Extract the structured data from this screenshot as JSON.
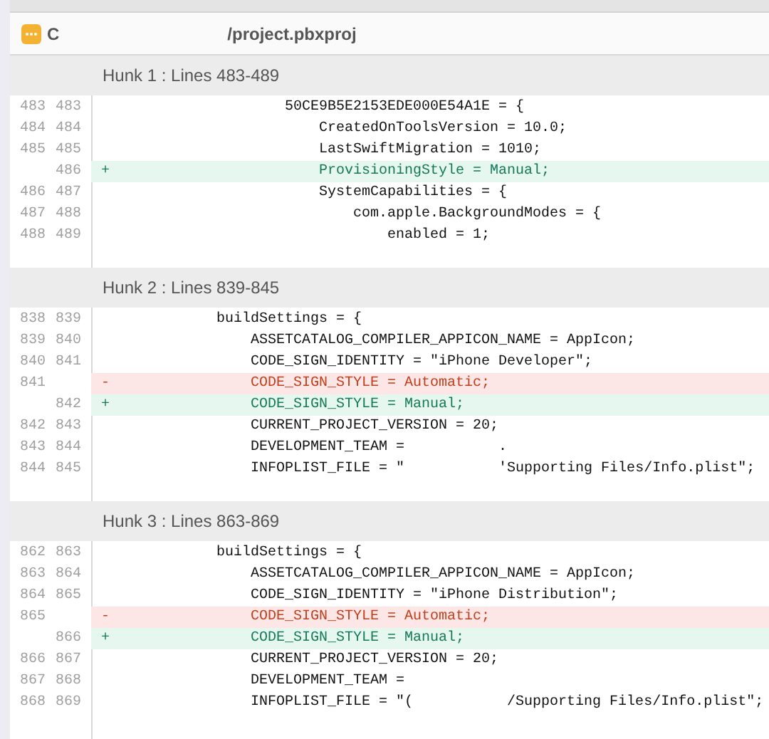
{
  "file": {
    "path": [
      "C",
      "/project.pbxproj"
    ]
  },
  "hunks": [
    {
      "title": "Hunk 1 : Lines 483-489",
      "lines": [
        {
          "kind": "context",
          "old": "483",
          "new": "483",
          "segments": [
            "                    50CE9B5E2153EDE000E54A1E = {"
          ]
        },
        {
          "kind": "context",
          "old": "484",
          "new": "484",
          "segments": [
            "                        CreatedOnToolsVersion = 10.0;"
          ]
        },
        {
          "kind": "context",
          "old": "485",
          "new": "485",
          "segments": [
            "                        LastSwiftMigration = 1010;"
          ]
        },
        {
          "kind": "added",
          "new": "486",
          "marker": "+",
          "segments": [
            "                        ProvisioningStyle = Manual;"
          ]
        },
        {
          "kind": "context",
          "old": "486",
          "new": "487",
          "segments": [
            "                        SystemCapabilities = {"
          ]
        },
        {
          "kind": "context",
          "old": "487",
          "new": "488",
          "segments": [
            "                            com.apple.BackgroundModes = {"
          ]
        },
        {
          "kind": "context",
          "old": "488",
          "new": "489",
          "segments": [
            "                                enabled = 1;"
          ]
        }
      ]
    },
    {
      "title": "Hunk 2 : Lines 839-845",
      "lines": [
        {
          "kind": "context",
          "old": "838",
          "new": "839",
          "segments": [
            "            buildSettings = {"
          ]
        },
        {
          "kind": "context",
          "old": "839",
          "new": "840",
          "segments": [
            "                ASSETCATALOG_COMPILER_APPICON_NAME = AppIcon;"
          ]
        },
        {
          "kind": "context",
          "old": "840",
          "new": "841",
          "segments": [
            "                CODE_SIGN_IDENTITY = \"iPhone Developer\";"
          ]
        },
        {
          "kind": "removed",
          "old": "841",
          "marker": "-",
          "segments": [
            "                CODE_SIGN_STYLE = Automatic;"
          ]
        },
        {
          "kind": "added",
          "new": "842",
          "marker": "+",
          "segments": [
            "                CODE_SIGN_STYLE = Manual;"
          ]
        },
        {
          "kind": "context",
          "old": "842",
          "new": "843",
          "segments": [
            "                CURRENT_PROJECT_VERSION = 20;"
          ]
        },
        {
          "kind": "context",
          "old": "843",
          "new": "844",
          "segments": [
            "                DEVELOPMENT_TEAM =",
            ". "
          ]
        },
        {
          "kind": "context",
          "old": "844",
          "new": "845",
          "segments": [
            "                INFOPLIST_FILE = \"",
            "'Supporting Files/Info.plist\";"
          ]
        }
      ]
    },
    {
      "title": "Hunk 3 : Lines 863-869",
      "lines": [
        {
          "kind": "context",
          "old": "862",
          "new": "863",
          "segments": [
            "            buildSettings = {"
          ]
        },
        {
          "kind": "context",
          "old": "863",
          "new": "864",
          "segments": [
            "                ASSETCATALOG_COMPILER_APPICON_NAME = AppIcon;"
          ]
        },
        {
          "kind": "context",
          "old": "864",
          "new": "865",
          "segments": [
            "                CODE_SIGN_IDENTITY = \"iPhone Distribution\";"
          ]
        },
        {
          "kind": "removed",
          "old": "865",
          "marker": "-",
          "segments": [
            "                CODE_SIGN_STYLE = Automatic;"
          ]
        },
        {
          "kind": "added",
          "new": "866",
          "marker": "+",
          "segments": [
            "                CODE_SIGN_STYLE = Manual;"
          ]
        },
        {
          "kind": "context",
          "old": "866",
          "new": "867",
          "segments": [
            "                CURRENT_PROJECT_VERSION = 20;"
          ]
        },
        {
          "kind": "context",
          "old": "867",
          "new": "868",
          "segments": [
            "                DEVELOPMENT_TEAM ="
          ]
        },
        {
          "kind": "context",
          "old": "868",
          "new": "869",
          "segments": [
            "                INFOPLIST_FILE = \"(",
            "/Supporting Files/Info.plist\";"
          ]
        }
      ]
    }
  ]
}
